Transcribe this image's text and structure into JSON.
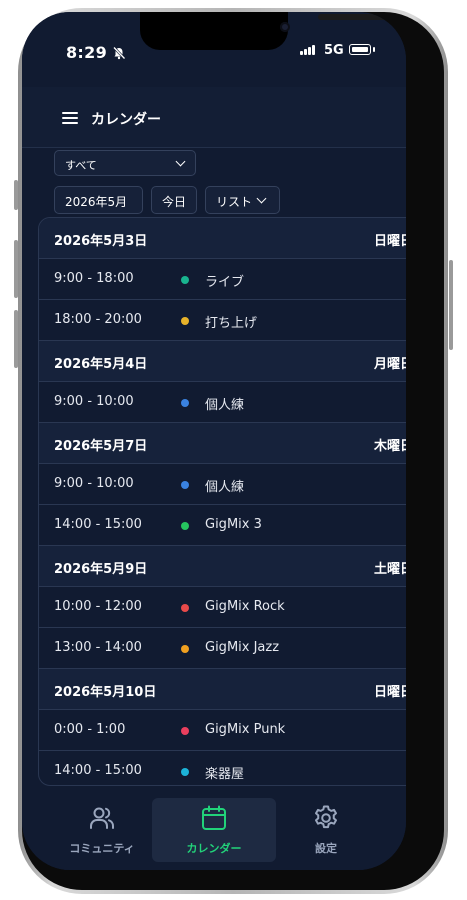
{
  "status_bar": {
    "time": "8:29",
    "network": "5G"
  },
  "header": {
    "title": "カレンダー"
  },
  "toolbar": {
    "filter_value": "すべて",
    "month_button": "2026年5月",
    "today_button": "今日",
    "view_select": "リスト"
  },
  "events": {
    "days": [
      {
        "date": "2026年5月3日",
        "weekday": "日曜日",
        "items": [
          {
            "time": "9:00 - 18:00",
            "name": "ライブ",
            "color": "#19b48f"
          },
          {
            "time": "18:00 - 20:00",
            "name": "打ち上げ",
            "color": "#e8b32a"
          }
        ]
      },
      {
        "date": "2026年5月4日",
        "weekday": "月曜日",
        "items": [
          {
            "time": "9:00 - 10:00",
            "name": "個人練",
            "color": "#3a82e0"
          }
        ]
      },
      {
        "date": "2026年5月7日",
        "weekday": "木曜日",
        "items": [
          {
            "time": "9:00 - 10:00",
            "name": "個人練",
            "color": "#3a82e0"
          },
          {
            "time": "14:00 - 15:00",
            "name": "GigMix 3",
            "color": "#26c45f"
          }
        ]
      },
      {
        "date": "2026年5月9日",
        "weekday": "土曜日",
        "items": [
          {
            "time": "10:00 - 12:00",
            "name": "GigMix Rock",
            "color": "#e84a4a"
          },
          {
            "time": "13:00 - 14:00",
            "name": "GigMix Jazz",
            "color": "#f0a020"
          }
        ]
      },
      {
        "date": "2026年5月10日",
        "weekday": "日曜日",
        "items": [
          {
            "time": "0:00 - 1:00",
            "name": "GigMix Punk",
            "color": "#ea3f5e"
          },
          {
            "time": "14:00 - 15:00",
            "name": "楽器屋",
            "color": "#1cb3d8"
          }
        ]
      }
    ]
  },
  "tabbar": {
    "tabs": [
      {
        "label": "コミュニティ",
        "icon": "users-icon",
        "active": false
      },
      {
        "label": "カレンダー",
        "icon": "calendar-icon",
        "active": true
      },
      {
        "label": "設定",
        "icon": "gear-icon",
        "active": false
      }
    ]
  },
  "colors": {
    "accent": "#22d37a",
    "background": "#111b31"
  }
}
